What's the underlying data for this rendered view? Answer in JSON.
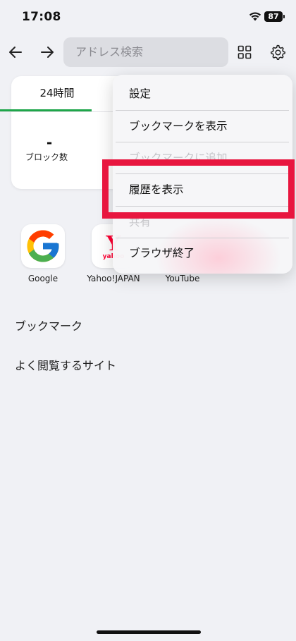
{
  "status_bar": {
    "time": "17:08",
    "battery": "87"
  },
  "toolbar": {
    "address_placeholder": "アドレス検索"
  },
  "stats": {
    "tab_label": "24時間",
    "value": "-",
    "label": "ブロック数"
  },
  "shortcuts": [
    {
      "label": "Google",
      "icon": "google-icon"
    },
    {
      "label": "Yahoo!JAPAN",
      "icon": "yahoo-japan-icon",
      "icon_text": "Y",
      "icon_subtext": "yahoo"
    },
    {
      "label": "YouTube",
      "icon": "youtube-icon"
    }
  ],
  "sections": {
    "bookmarks": "ブックマーク",
    "frequent": "よく閲覧するサイト"
  },
  "menu": {
    "items": [
      {
        "label": "設定",
        "enabled": true
      },
      {
        "label": "ブックマークを表示",
        "enabled": true
      },
      {
        "label": "ブックマークに追加",
        "enabled": false
      },
      {
        "label": "履歴を表示",
        "enabled": true
      },
      {
        "label": "共有",
        "enabled": false
      },
      {
        "label": "ブラウザ終了",
        "enabled": true
      }
    ]
  },
  "colors": {
    "accent_green": "#1ea64a",
    "highlight_red": "#e8163f",
    "yahoo_red": "#ff0033"
  }
}
